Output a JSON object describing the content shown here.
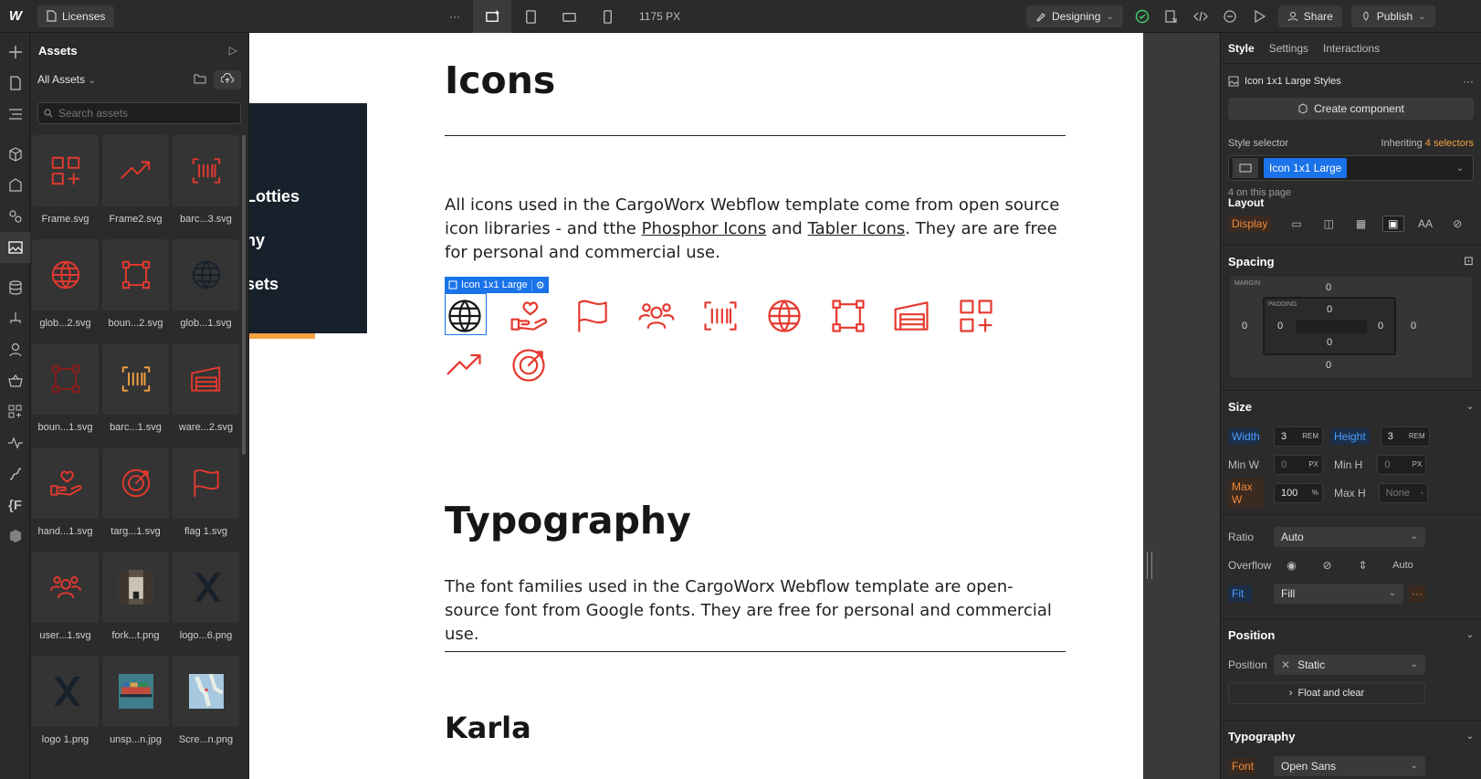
{
  "topbar": {
    "logo": "W",
    "page_name": "Licenses",
    "more": "···",
    "width_readout": "1175 PX",
    "mode": "Designing",
    "share": "Share",
    "publish": "Publish"
  },
  "assets_panel": {
    "title": "Assets",
    "filter": "All Assets",
    "search_placeholder": "Search assets",
    "items": [
      {
        "label": "Frame.svg",
        "icon": "grid-plus-icon",
        "color": "#e5392f"
      },
      {
        "label": "Frame2.svg",
        "icon": "trend-up-icon",
        "color": "#e5392f"
      },
      {
        "label": "barc...3.svg",
        "icon": "barcode-icon",
        "color": "#e5392f"
      },
      {
        "label": "glob...2.svg",
        "icon": "globe-icon",
        "color": "#e5392f"
      },
      {
        "label": "boun...2.svg",
        "icon": "bounding-box-icon",
        "color": "#e5392f"
      },
      {
        "label": "glob...1.svg",
        "icon": "globe-icon",
        "color": "#17212b"
      },
      {
        "label": "boun...1.svg",
        "icon": "bounding-box-icon",
        "color": "#8a1c1c"
      },
      {
        "label": "barc...1.svg",
        "icon": "barcode-icon",
        "color": "#f4a340"
      },
      {
        "label": "ware...2.svg",
        "icon": "warehouse-icon",
        "color": "#e5392f"
      },
      {
        "label": "hand...1.svg",
        "icon": "hand-heart-icon",
        "color": "#e5392f"
      },
      {
        "label": "targ...1.svg",
        "icon": "target-icon",
        "color": "#e5392f"
      },
      {
        "label": "flag 1.svg",
        "icon": "flag-icon",
        "color": "#e5392f"
      },
      {
        "label": "user...1.svg",
        "icon": "users-icon",
        "color": "#e5392f"
      },
      {
        "label": "fork...t.png",
        "icon": "photo-warehouse",
        "color": "#5b5146"
      },
      {
        "label": "logo...6.png",
        "icon": "logo-x-icon",
        "color": "#17212b"
      },
      {
        "label": "logo 1.png",
        "icon": "logo-x-icon",
        "color": "#17212b"
      },
      {
        "label": "unsp...n.jpg",
        "icon": "photo-ship",
        "color": "#3f7d8a"
      },
      {
        "label": "Scre...n.png",
        "icon": "photo-map",
        "color": "#a8c8e0"
      }
    ]
  },
  "canvas": {
    "card_lines": [
      "Lotties",
      "hy",
      "sets"
    ],
    "icons_heading": "Icons",
    "icons_para_1": "All icons used in the CargoWorx Webflow template come from open source icon libraries - and tthe ",
    "link_1": "Phosphor Icons",
    "icons_para_2": " and ",
    "link_2": "Tabler Icons",
    "icons_para_3": ". They are are free for personal and commercial use.",
    "selection_tag": "Icon 1x1 Large",
    "typography_heading": "Typography",
    "typography_para": "The font families used in the CargoWorx Webflow template are open-source font from Google fonts. They are free for personal and commercial use.",
    "karla_heading": "Karla",
    "accent_color": "#e5392f"
  },
  "right_panel": {
    "tabs": [
      "Style",
      "Settings",
      "Interactions"
    ],
    "styles_header": "Icon 1x1 Large Styles",
    "create_component": "Create component",
    "style_selector_label": "Style selector",
    "inheriting_prefix": "Inheriting ",
    "inheriting_count": "4 selectors",
    "selector_chip": "Icon 1x1 Large",
    "on_page": "4 on this page",
    "layout_title": "Layout",
    "display_label": "Display",
    "spacing_title": "Spacing",
    "margin_label": "MARGIN",
    "padding_label": "PADDING",
    "margin": {
      "top": "0",
      "right": "0",
      "bottom": "0",
      "left": "0"
    },
    "padding": {
      "top": "0",
      "right": "0",
      "bottom": "0",
      "left": "0"
    },
    "size_title": "Size",
    "width_label": "Width",
    "width_value": "3",
    "width_unit": "REM",
    "height_label": "Height",
    "height_value": "3",
    "height_unit": "REM",
    "minw_label": "Min W",
    "minw_value": "0",
    "minw_unit": "PX",
    "minh_label": "Min H",
    "minh_value": "0",
    "minh_unit": "PX",
    "maxw_label": "Max W",
    "maxw_value": "100",
    "maxw_unit": "%",
    "maxh_label": "Max H",
    "maxh_value": "None",
    "maxh_unit": "-",
    "ratio_label": "Ratio",
    "ratio_value": "Auto",
    "overflow_label": "Overflow",
    "overflow_auto": "Auto",
    "fit_label": "Fit",
    "fit_value": "Fill",
    "position_title": "Position",
    "position_label": "Position",
    "position_value": "Static",
    "float_clear": "Float and clear",
    "typography_title": "Typography",
    "font_label": "Font",
    "font_value": "Open Sans"
  }
}
